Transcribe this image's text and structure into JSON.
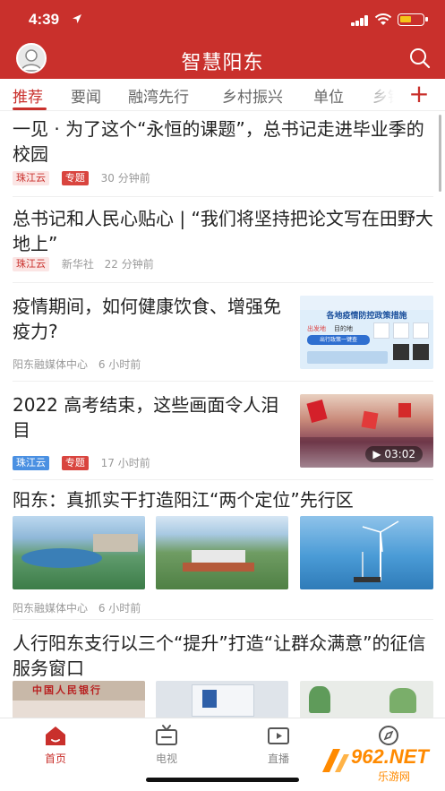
{
  "status_bar": {
    "time": "4:39"
  },
  "header": {
    "title": "智慧阳东"
  },
  "tabs": [
    "推荐",
    "要闻",
    "融湾先行",
    "乡村振兴",
    "单位",
    "乡镇"
  ],
  "feed": [
    {
      "headline": "一见 · 为了这个“永恒的课题”，总书记走进毕业季的校园",
      "tags": [
        "珠江云",
        "专题"
      ],
      "time": "30 分钟前"
    },
    {
      "headline": "总书记和人民心贴心 | “我们将坚持把论文写在田野大地上”",
      "tags": [
        "珠江云"
      ],
      "source": "新华社",
      "time": "22 分钟前"
    },
    {
      "headline": "疫情期间，如何健康饮食、增强免疫力?",
      "source": "阳东融媒体中心",
      "time": "6 小时前",
      "thumb_title": "各地疫情防控政策措施",
      "thumb_sub": "出发地",
      "thumb_sub2": "目的地",
      "thumb_sub3": "出行政策一键查"
    },
    {
      "headline": "2022 高考结束，这些画面令人泪目",
      "tags": [
        "珠江云",
        "专题"
      ],
      "time": "17 小时前",
      "duration": "03:02"
    },
    {
      "headline": "阳东：真抓实干打造阳江“两个定位”先行区",
      "source": "阳东融媒体中心",
      "time": "6 小时前"
    },
    {
      "headline": "人行阳东支行以三个“提升”打造“让群众满意”的征信服务窗口",
      "thumb_text": "中国人民银行"
    }
  ],
  "bottom_nav": [
    {
      "label": "首页",
      "icon": "home-icon"
    },
    {
      "label": "电视",
      "icon": "tv-icon"
    },
    {
      "label": "直播",
      "icon": "live-icon"
    },
    {
      "label": "",
      "icon": "compass-icon"
    }
  ],
  "watermark": {
    "text": "962.NET",
    "sub": "乐游网"
  },
  "colors": {
    "brand": "#c9302c",
    "tag_blue": "#4a90e2"
  }
}
